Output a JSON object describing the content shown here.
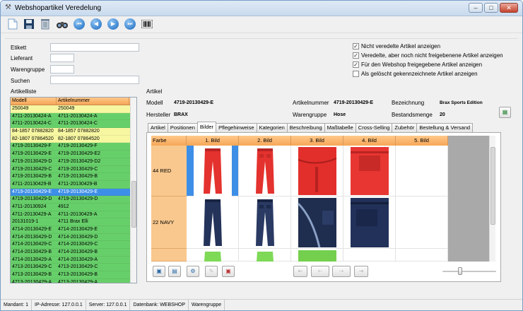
{
  "window": {
    "title": "Webshopartikel Veredelung"
  },
  "filters": {
    "etikett_label": "Etikett",
    "lieferant_label": "Lieferant",
    "warengruppe_label": "Warengruppe",
    "suchen_label": "Suchen",
    "etikett_value": "",
    "lieferant_value": "",
    "warengruppe_value": "",
    "suchen_value": ""
  },
  "options": [
    {
      "label": "Nicht veredelte Artikel anzeigen",
      "checked": true
    },
    {
      "label": "Veredelte, aber noch nicht freigebenene Artikel anzeigen",
      "checked": true
    },
    {
      "label": "Für den Webshop freigegebene Artikel anzeigen",
      "checked": true
    },
    {
      "label": "Als gelöscht gekennzeichnete Artikel anzeigen",
      "checked": false
    }
  ],
  "artikelliste": {
    "title": "Artikelliste",
    "columns": [
      "Modell",
      "Artikelnummer"
    ],
    "rows": [
      {
        "modell": "250049",
        "artikelnummer": "250049",
        "color": "yellow"
      },
      {
        "modell": "4711-20130424-A",
        "artikelnummer": "4711-20130424-A",
        "color": "green"
      },
      {
        "modell": "4711-20130424-C",
        "artikelnummer": "4711-20130424-C",
        "color": "green"
      },
      {
        "modell": "84-1857 07882820",
        "artikelnummer": "84-1857 07882820",
        "color": "yellow"
      },
      {
        "modell": "82-1807 07864520",
        "artikelnummer": "82-1807 07864520",
        "color": "yellow"
      },
      {
        "modell": "4719-20130429-F",
        "artikelnummer": "4719-20130429-F",
        "color": "green"
      },
      {
        "modell": "4719-20130429-E",
        "artikelnummer": "4719-20130429-E2",
        "color": "green"
      },
      {
        "modell": "4719-20130429-D",
        "artikelnummer": "4719-20130429-D2",
        "color": "green"
      },
      {
        "modell": "4719-20130429-C",
        "artikelnummer": "4719-20130429-C",
        "color": "green"
      },
      {
        "modell": "4719-20130429-B",
        "artikelnummer": "4719-20130429-B",
        "color": "green"
      },
      {
        "modell": "4711-20130429-B",
        "artikelnummer": "4711-20130429-B",
        "color": "green"
      },
      {
        "modell": "4719-20130429-E",
        "artikelnummer": "4719-20130429-E",
        "color": "sel"
      },
      {
        "modell": "4719-20130429-D",
        "artikelnummer": "4719-20130429-D",
        "color": "green"
      },
      {
        "modell": "4711-20130924",
        "artikelnummer": "4912",
        "color": "green"
      },
      {
        "modell": "4711-20130429-A",
        "artikelnummer": "4711-20130429-A",
        "color": "green"
      },
      {
        "modell": "20131019-1",
        "artikelnummer": "4711 Brax Elli",
        "color": "green"
      },
      {
        "modell": "4714-20130429-E",
        "artikelnummer": "4714-20130429-E",
        "color": "green"
      },
      {
        "modell": "4714-20130429-D",
        "artikelnummer": "4714-20130429-D",
        "color": "green"
      },
      {
        "modell": "4714-20130429-C",
        "artikelnummer": "4714-20130429-C",
        "color": "green"
      },
      {
        "modell": "4714-20130429-B",
        "artikelnummer": "4714-20130429-B",
        "color": "green"
      },
      {
        "modell": "4714-20130429-A",
        "artikelnummer": "4714-20130429-A",
        "color": "green"
      },
      {
        "modell": "4713-20130429-C",
        "artikelnummer": "4713-20130429-C",
        "color": "green"
      },
      {
        "modell": "4713-20130429-B",
        "artikelnummer": "4713-20130429-B",
        "color": "green"
      },
      {
        "modell": "4713-20130429-A",
        "artikelnummer": "4713-20130429-A",
        "color": "green"
      }
    ]
  },
  "artikel": {
    "title": "Artikel",
    "modell_label": "Modell",
    "modell_value": "4719-20130429-E",
    "hersteller_label": "Hersteller",
    "hersteller_value": "BRAX",
    "artikelnummer_label": "Artikelnummer",
    "artikelnummer_value": "4719-20130429-E",
    "warengruppe_label": "Warengruppe",
    "warengruppe_value": "Hose",
    "bezeichnung_label": "Bezeichnung",
    "bezeichnung_value": "Brax Sports Edition",
    "bestandsmenge_label": "Bestandsmenge",
    "bestandsmenge_value": "20"
  },
  "tabs": [
    "Artikel",
    "Positionen",
    "Bilder",
    "Pflegehinweise",
    "Kategorien",
    "Beschreibung",
    "Maßtabelle",
    "Cross-Selling",
    "Zubehör",
    "Bestellung & Versand"
  ],
  "active_tab": "Bilder",
  "bilder": {
    "columns": [
      "Farbe",
      "1. Bild",
      "2. Bild",
      "3. Bild",
      "4. Bild",
      "5. Bild"
    ],
    "rows": [
      {
        "farbe": "44 RED",
        "images": [
          "red-pants-front",
          "red-pants-back",
          "red-pants-detail",
          "red-pants-detail-2"
        ]
      },
      {
        "farbe": "22 NAVY",
        "images": [
          "navy-pants-front",
          "navy-pants-back",
          "navy-pants-detail",
          "navy-pants-detail-2"
        ]
      },
      {
        "farbe": "",
        "images": [
          "green-pants-front",
          "green-pants-back",
          "green-pants-detail"
        ]
      }
    ]
  },
  "statusbar": {
    "mandant": "Mandant: 1",
    "ip": "IP-Adresse: 127.0.0.1",
    "server": "Server: 127.0.0.1",
    "datenbank": "Datenbank: WEBSHOP",
    "warengruppe": "Warengruppe"
  },
  "colors": {
    "green": "#67cf6a",
    "yellow": "#f7f7a2",
    "selected": "#3d8ee6",
    "header": "#f6a657",
    "red_pants": "#e4322e",
    "navy_pants": "#24335a",
    "green_pants": "#7ed957"
  }
}
